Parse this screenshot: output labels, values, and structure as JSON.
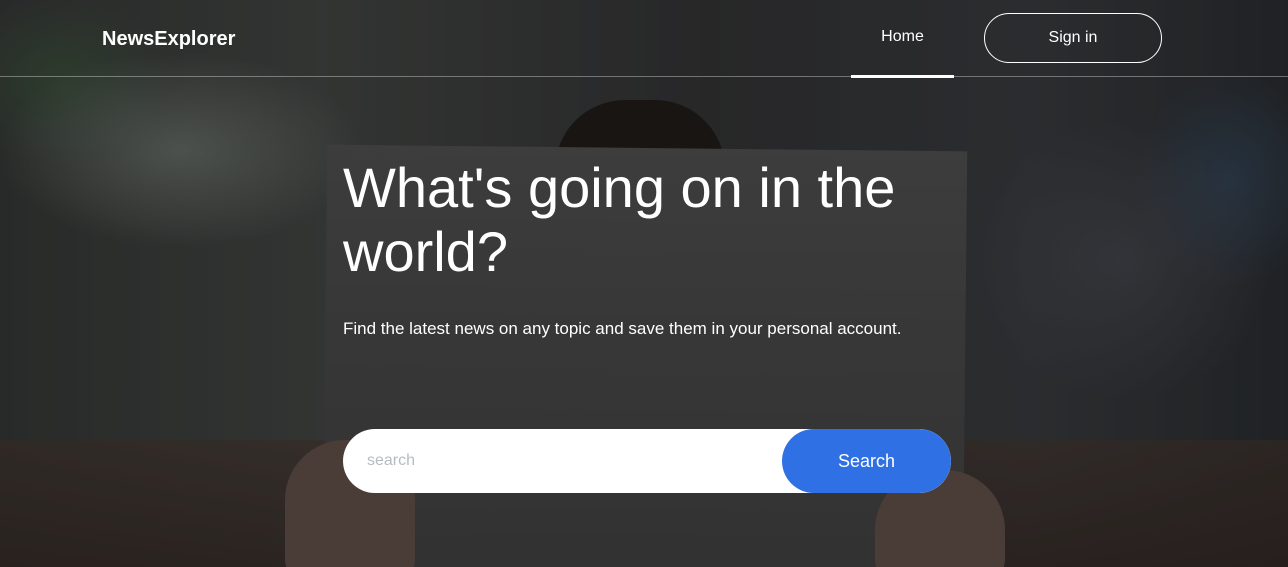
{
  "header": {
    "logo": "NewsExplorer",
    "nav": {
      "home_label": "Home",
      "signin_label": "Sign in"
    }
  },
  "hero": {
    "title": "What's going on in the world?",
    "subtitle": "Find the latest news on any topic and save them in your personal account."
  },
  "search": {
    "placeholder": "search",
    "value": "",
    "button_label": "Search"
  },
  "colors": {
    "accent": "#2f71e5",
    "text": "#ffffff",
    "placeholder": "#b6bcbf"
  }
}
